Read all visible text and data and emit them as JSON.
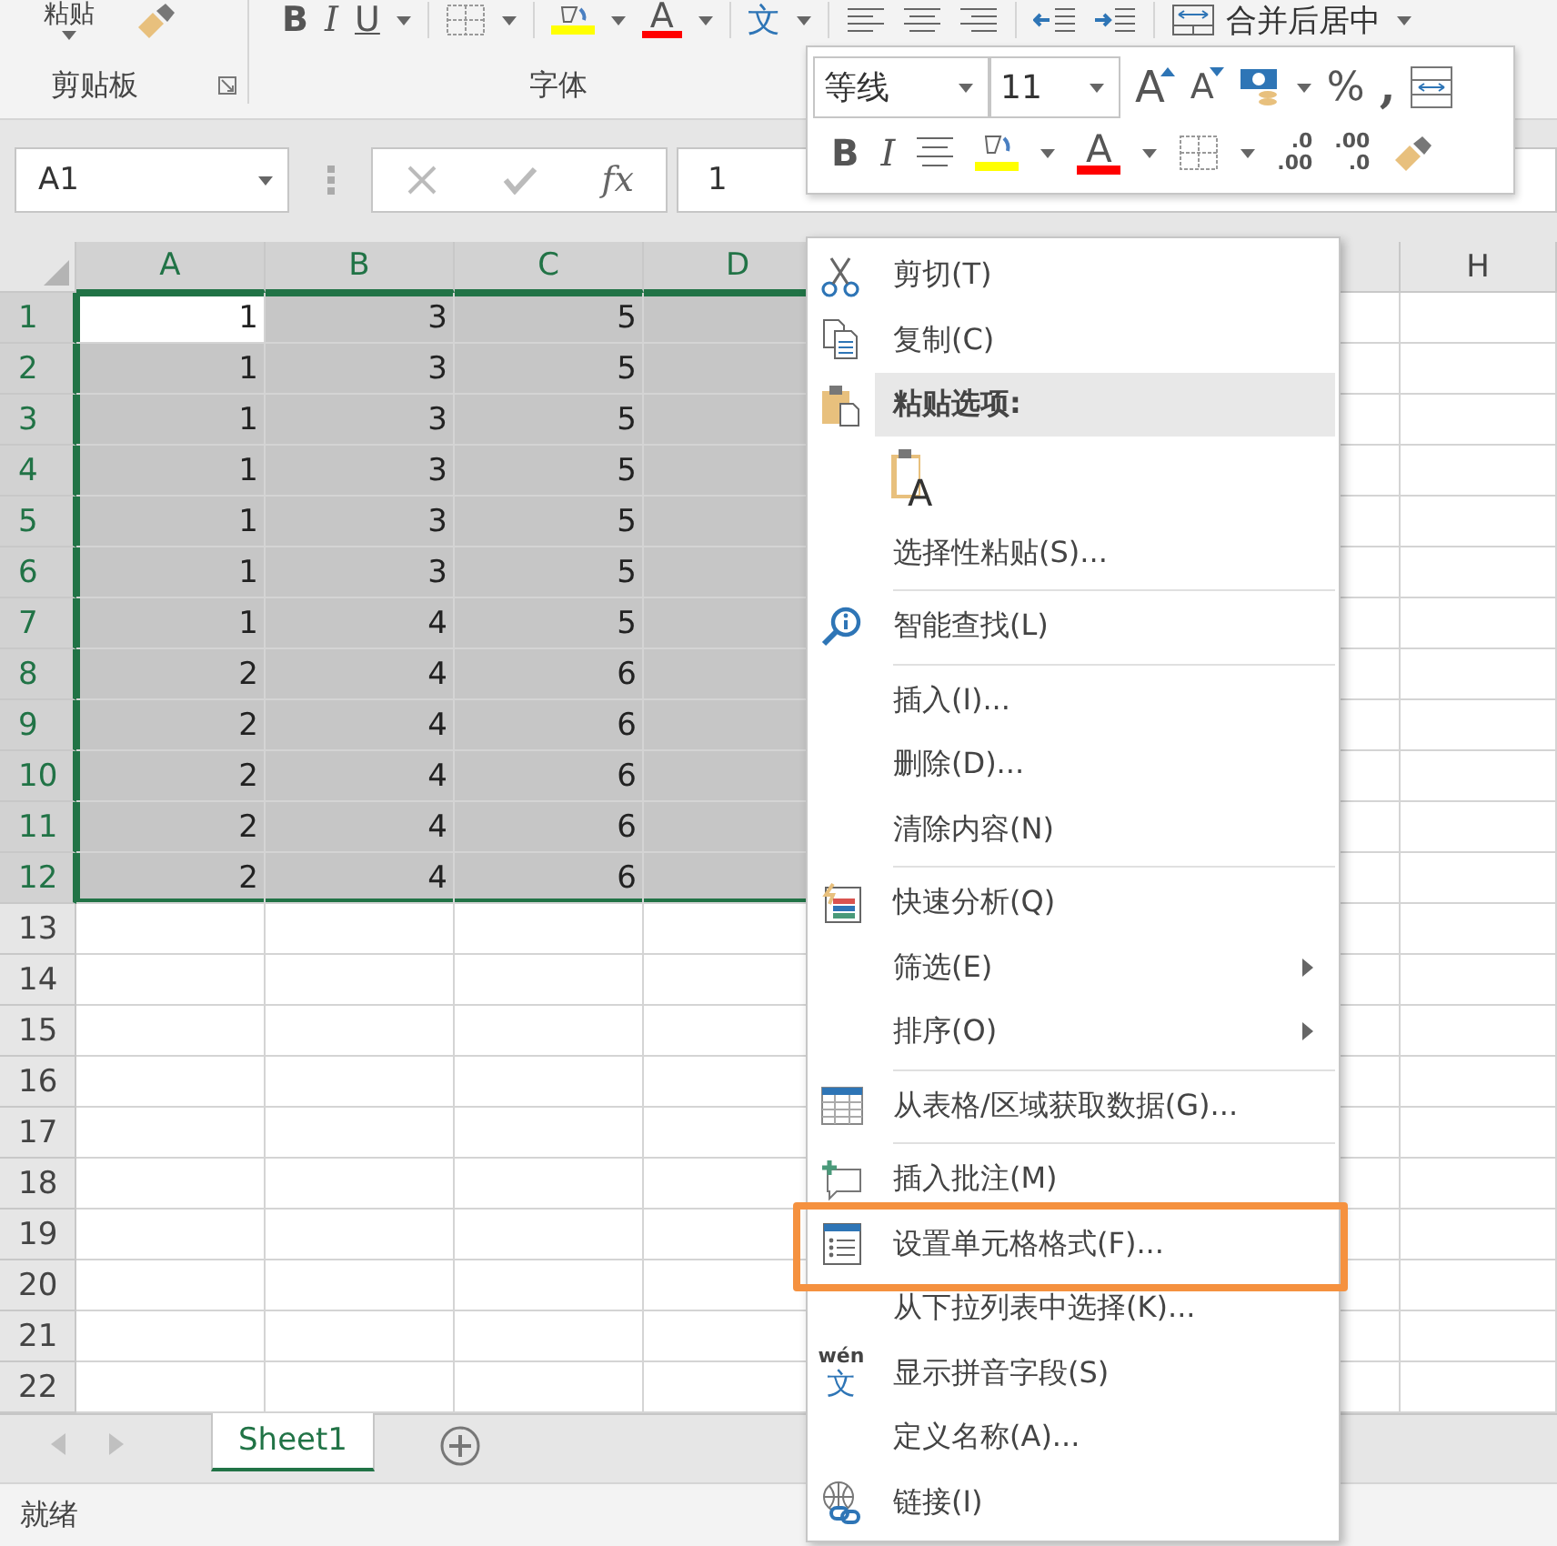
{
  "ribbon": {
    "paste_label": "粘贴",
    "group_labels": [
      "剪贴板",
      "字体"
    ],
    "bold": "B",
    "italic": "I",
    "underline": "U",
    "font_color": "A",
    "phonetic": "文",
    "merge": "合并后居中"
  },
  "formula_bar": {
    "name_box": "A1",
    "fx": "fx",
    "value": "1"
  },
  "columns": [
    {
      "label": "A",
      "selected": true
    },
    {
      "label": "B",
      "selected": true
    },
    {
      "label": "C",
      "selected": true
    },
    {
      "label": "D",
      "selected": true
    },
    {
      "label": "H",
      "selected": false
    }
  ],
  "rows": [
    {
      "header": "1",
      "selected": true,
      "cells": [
        {
          "value": "1",
          "active": true
        },
        {
          "value": "3",
          "active": false
        },
        {
          "value": "5",
          "active": false
        }
      ]
    },
    {
      "header": "2",
      "selected": true,
      "cells": [
        {
          "value": "1",
          "active": false
        },
        {
          "value": "3",
          "active": false
        },
        {
          "value": "5",
          "active": false
        }
      ]
    },
    {
      "header": "3",
      "selected": true,
      "cells": [
        {
          "value": "1",
          "active": false
        },
        {
          "value": "3",
          "active": false
        },
        {
          "value": "5",
          "active": false
        }
      ]
    },
    {
      "header": "4",
      "selected": true,
      "cells": [
        {
          "value": "1",
          "active": false
        },
        {
          "value": "3",
          "active": false
        },
        {
          "value": "5",
          "active": false
        }
      ]
    },
    {
      "header": "5",
      "selected": true,
      "cells": [
        {
          "value": "1",
          "active": false
        },
        {
          "value": "3",
          "active": false
        },
        {
          "value": "5",
          "active": false
        }
      ]
    },
    {
      "header": "6",
      "selected": true,
      "cells": [
        {
          "value": "1",
          "active": false
        },
        {
          "value": "3",
          "active": false
        },
        {
          "value": "5",
          "active": false
        }
      ]
    },
    {
      "header": "7",
      "selected": true,
      "cells": [
        {
          "value": "1",
          "active": false
        },
        {
          "value": "4",
          "active": false
        },
        {
          "value": "5",
          "active": false
        }
      ]
    },
    {
      "header": "8",
      "selected": true,
      "cells": [
        {
          "value": "2",
          "active": false
        },
        {
          "value": "4",
          "active": false
        },
        {
          "value": "6",
          "active": false
        }
      ]
    },
    {
      "header": "9",
      "selected": true,
      "cells": [
        {
          "value": "2",
          "active": false
        },
        {
          "value": "4",
          "active": false
        },
        {
          "value": "6",
          "active": false
        }
      ]
    },
    {
      "header": "10",
      "selected": true,
      "cells": [
        {
          "value": "2",
          "active": false
        },
        {
          "value": "4",
          "active": false
        },
        {
          "value": "6",
          "active": false
        }
      ]
    },
    {
      "header": "11",
      "selected": true,
      "cells": [
        {
          "value": "2",
          "active": false
        },
        {
          "value": "4",
          "active": false
        },
        {
          "value": "6",
          "active": false
        }
      ]
    },
    {
      "header": "12",
      "selected": true,
      "cells": [
        {
          "value": "2",
          "active": false
        },
        {
          "value": "4",
          "active": false
        },
        {
          "value": "6",
          "active": false
        }
      ]
    },
    {
      "header": "13",
      "selected": false
    },
    {
      "header": "14",
      "selected": false
    },
    {
      "header": "15",
      "selected": false
    },
    {
      "header": "16",
      "selected": false
    },
    {
      "header": "17",
      "selected": false
    },
    {
      "header": "18",
      "selected": false
    },
    {
      "header": "19",
      "selected": false
    },
    {
      "header": "20",
      "selected": false
    },
    {
      "header": "21",
      "selected": false
    },
    {
      "header": "22",
      "selected": false
    }
  ],
  "sheet_tabs": [
    {
      "label": "Sheet1",
      "selected": true
    }
  ],
  "status": "就绪",
  "mini_toolbar": {
    "font": "等线",
    "size": "11",
    "grow": "A",
    "shrink": "A",
    "percent": "%",
    "comma": ",",
    "bold": "B",
    "italic": "I",
    "font_color": "A",
    "increase_decimal": [
      ".0",
      ".00"
    ],
    "decrease_decimal": [
      ".00",
      ".0"
    ]
  },
  "context_menu": {
    "items": [
      {
        "kind": "item",
        "label": "剪切(T)"
      },
      {
        "kind": "item",
        "label": "复制(C)"
      },
      {
        "kind": "header",
        "label": "粘贴选项:"
      },
      {
        "kind": "paste-option",
        "glyph": "A"
      },
      {
        "kind": "item",
        "label": "选择性粘贴(S)..."
      },
      {
        "kind": "separator"
      },
      {
        "kind": "item",
        "label": "智能查找(L)"
      },
      {
        "kind": "separator"
      },
      {
        "kind": "item",
        "label": "插入(I)..."
      },
      {
        "kind": "item",
        "label": "删除(D)..."
      },
      {
        "kind": "item",
        "label": "清除内容(N)"
      },
      {
        "kind": "separator"
      },
      {
        "kind": "item",
        "label": "快速分析(Q)"
      },
      {
        "kind": "item",
        "label": "筛选(E)",
        "submenu": true
      },
      {
        "kind": "item",
        "label": "排序(O)",
        "submenu": true
      },
      {
        "kind": "separator"
      },
      {
        "kind": "item",
        "label": "从表格/区域获取数据(G)..."
      },
      {
        "kind": "separator"
      },
      {
        "kind": "item",
        "label": "插入批注(M)"
      },
      {
        "kind": "item",
        "label": "设置单元格格式(F)...",
        "highlighted": true
      },
      {
        "kind": "item",
        "label": "从下拉列表中选择(K)..."
      },
      {
        "kind": "item",
        "label": "显示拼音字段(S)",
        "icon_text": [
          "wén",
          "文"
        ]
      },
      {
        "kind": "item",
        "label": "定义名称(A)..."
      },
      {
        "kind": "item",
        "label": "链接(I)"
      }
    ]
  }
}
